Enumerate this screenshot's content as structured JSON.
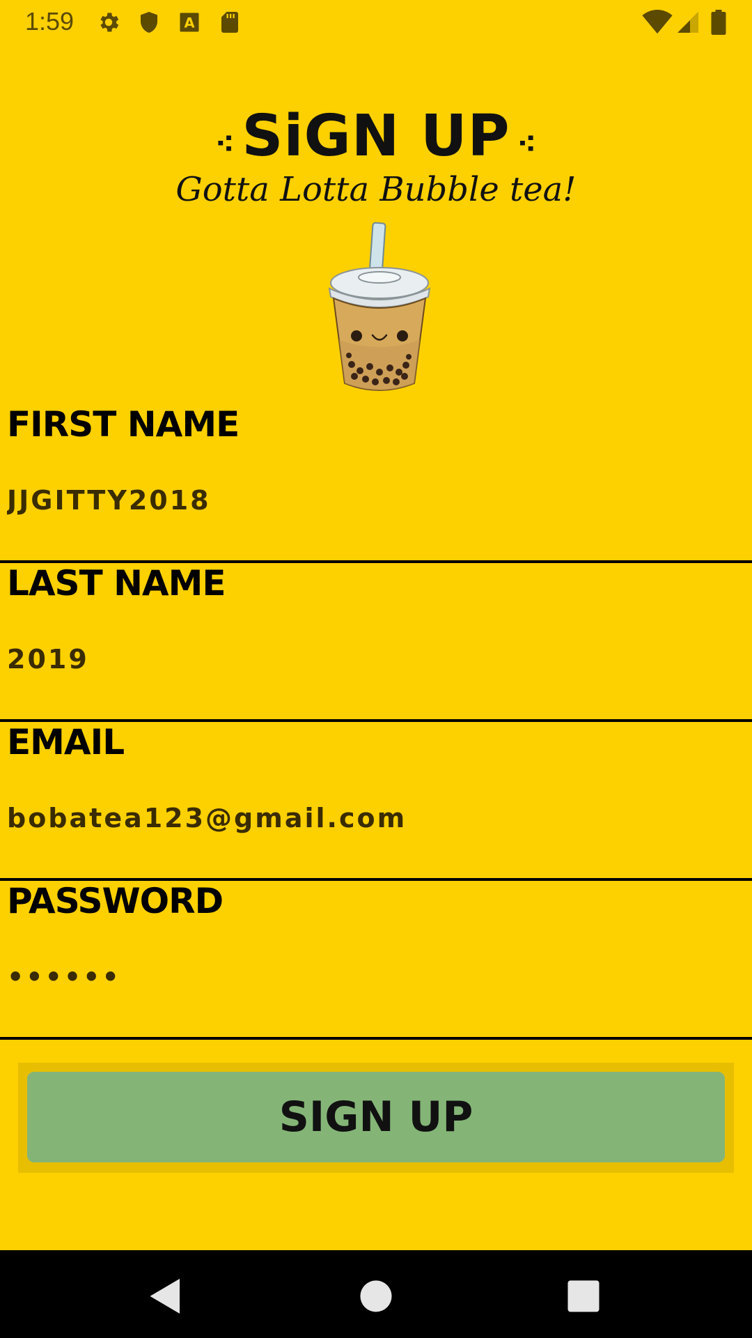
{
  "status_bar": {
    "time": "1:59",
    "icons": [
      "gear-icon",
      "shield-icon",
      "a-icon",
      "sd-card-icon",
      "wifi-icon",
      "signal-icon",
      "battery-icon"
    ]
  },
  "header": {
    "title": "SiGN UP",
    "subtitle": "Gotta Lotta Bubble tea!",
    "image": "boba-tea-cup"
  },
  "form": {
    "first_name": {
      "label": "FIRST NAME",
      "value": "JJGITTY2018"
    },
    "last_name": {
      "label": "LAST NAME",
      "value": "2019"
    },
    "email": {
      "label": "EMAIL",
      "value": "bobatea123@gmail.com"
    },
    "password": {
      "label": "PASSWORD",
      "value": "••••••"
    }
  },
  "signup_button": {
    "label": "SIGN UP"
  },
  "nav_bar": {
    "icons": [
      "back-icon",
      "home-icon",
      "recents-icon"
    ]
  },
  "colors": {
    "background": "#FDD000",
    "button": "#84B577",
    "button_frame": "#E7BF00",
    "text": "#000000"
  }
}
